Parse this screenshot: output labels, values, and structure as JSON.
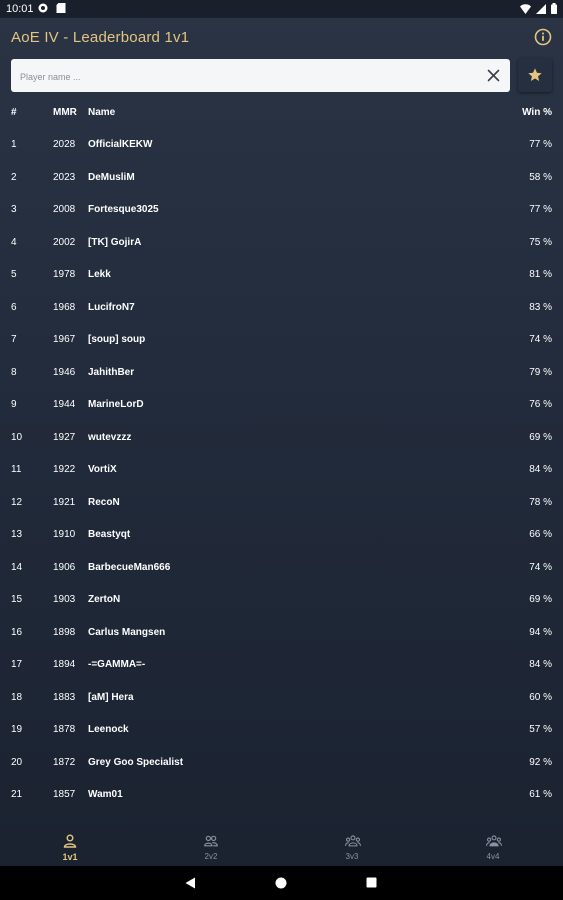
{
  "status_bar": {
    "time": "10:01"
  },
  "header": {
    "title": "AoE IV - Leaderboard 1v1"
  },
  "search": {
    "placeholder": "Player name ..."
  },
  "table": {
    "headers": {
      "rank": "#",
      "mmr": "MMR",
      "name": "Name",
      "win": "Win %"
    },
    "rows": [
      {
        "rank": "1",
        "mmr": "2028",
        "name": "OfficialKEKW",
        "win": "77 %"
      },
      {
        "rank": "2",
        "mmr": "2023",
        "name": "DeMusliM",
        "win": "58 %"
      },
      {
        "rank": "3",
        "mmr": "2008",
        "name": "Fortesque3025",
        "win": "77 %"
      },
      {
        "rank": "4",
        "mmr": "2002",
        "name": "[TK] GojirA",
        "win": "75 %"
      },
      {
        "rank": "5",
        "mmr": "1978",
        "name": "Lekk",
        "win": "81 %"
      },
      {
        "rank": "6",
        "mmr": "1968",
        "name": "LucifroN7",
        "win": "83 %"
      },
      {
        "rank": "7",
        "mmr": "1967",
        "name": "[soup] soup",
        "win": "74 %"
      },
      {
        "rank": "8",
        "mmr": "1946",
        "name": "JahithBer",
        "win": "79 %"
      },
      {
        "rank": "9",
        "mmr": "1944",
        "name": "MarineLorD",
        "win": "76 %"
      },
      {
        "rank": "10",
        "mmr": "1927",
        "name": "wutevzzz",
        "win": "69 %"
      },
      {
        "rank": "11",
        "mmr": "1922",
        "name": "VortiX",
        "win": "84 %"
      },
      {
        "rank": "12",
        "mmr": "1921",
        "name": "RecoN",
        "win": "78 %"
      },
      {
        "rank": "13",
        "mmr": "1910",
        "name": "Beastyqt",
        "win": "66 %"
      },
      {
        "rank": "14",
        "mmr": "1906",
        "name": "BarbecueMan666",
        "win": "74 %"
      },
      {
        "rank": "15",
        "mmr": "1903",
        "name": "ZertoN",
        "win": "69 %"
      },
      {
        "rank": "16",
        "mmr": "1898",
        "name": "Carlus Mangsen",
        "win": "94 %"
      },
      {
        "rank": "17",
        "mmr": "1894",
        "name": "-=GAMMA=-",
        "win": "84 %"
      },
      {
        "rank": "18",
        "mmr": "1883",
        "name": "[aM] Hera",
        "win": "60 %"
      },
      {
        "rank": "19",
        "mmr": "1878",
        "name": "Leenock",
        "win": "57 %"
      },
      {
        "rank": "20",
        "mmr": "1872",
        "name": "Grey Goo Specialist",
        "win": "92 %"
      },
      {
        "rank": "21",
        "mmr": "1857",
        "name": "Wam01",
        "win": "61 %"
      }
    ]
  },
  "bottom_nav": {
    "items": [
      {
        "label": "1v1",
        "icon": "person-icon",
        "active": true
      },
      {
        "label": "2v2",
        "icon": "two-people-icon",
        "active": false
      },
      {
        "label": "3v3",
        "icon": "three-people-icon",
        "active": false
      },
      {
        "label": "4v4",
        "icon": "four-people-icon",
        "active": false
      }
    ]
  },
  "colors": {
    "accent": "#e3c580",
    "background": "#222b3b",
    "text": "#ffffff",
    "inactive": "#8b93a3"
  }
}
